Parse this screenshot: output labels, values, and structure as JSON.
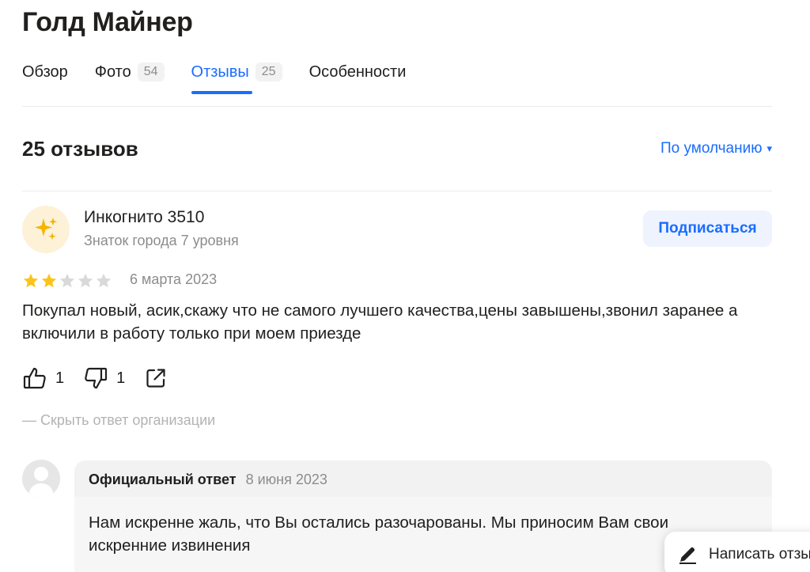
{
  "header": {
    "title": "Голд Майнер"
  },
  "tabs": [
    {
      "label": "Обзор",
      "count": ""
    },
    {
      "label": "Фото",
      "count": "54"
    },
    {
      "label": "Отзывы",
      "count": "25"
    },
    {
      "label": "Особенности",
      "count": ""
    }
  ],
  "reviews": {
    "count_label": "25 отзывов",
    "sort_label": "По умолчанию",
    "sort_caret": "▾"
  },
  "review": {
    "author": "Инкогнито 3510",
    "level": "Знаток города 7 уровня",
    "subscribe_label": "Подписаться",
    "rating": 2,
    "rating_max": 5,
    "date": "6 марта 2023",
    "text": "Покупал новый, асик,скажу что не самого лучшего качества,цены завышены,звонил заранее а включили в работу только при моем приезде",
    "likes": "1",
    "dislikes": "1",
    "hide_answer_label": "— Скрыть ответ организации",
    "avatar_icon": "sparkles-icon"
  },
  "org_answer": {
    "label": "Официальный ответ",
    "date": "8 июня 2023",
    "text": "Нам искренне жаль, что Вы остались разочарованы. Мы приносим Вам свои искренние извинения"
  },
  "fab": {
    "label": "Написать отзыв"
  },
  "colors": {
    "accent": "#196dff",
    "star_filled": "#fcc419",
    "star_empty": "#d9d9d9",
    "muted": "#8c8c8c"
  }
}
